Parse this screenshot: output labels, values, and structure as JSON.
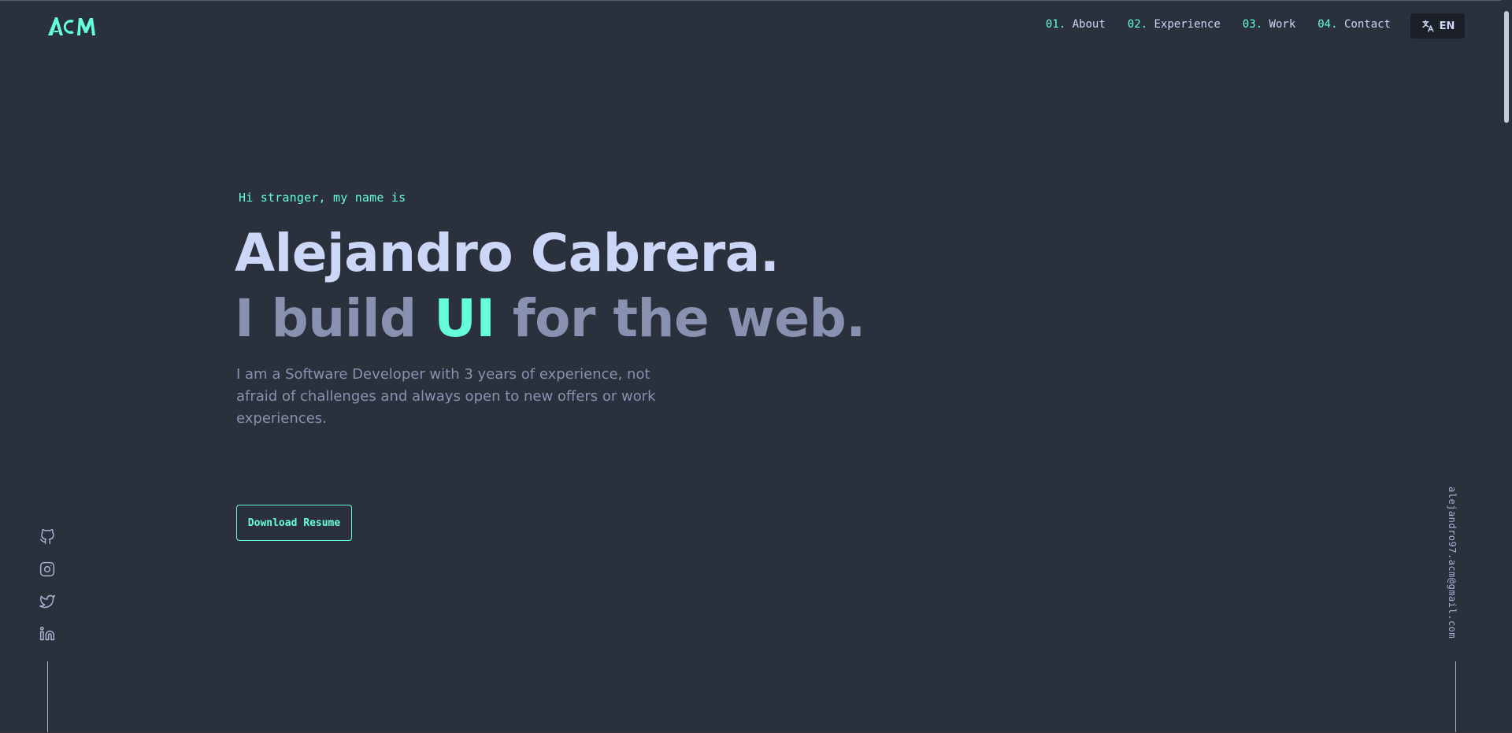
{
  "header": {
    "logo_text": "ACM",
    "nav": [
      {
        "num": "01.",
        "label": "About"
      },
      {
        "num": "02.",
        "label": "Experience"
      },
      {
        "num": "03.",
        "label": "Work"
      },
      {
        "num": "04.",
        "label": "Contact"
      }
    ],
    "language": {
      "icon": "translate-icon",
      "label": "EN"
    }
  },
  "hero": {
    "greeting": "Hi stranger, my name is",
    "name": "Alejandro Cabrera.",
    "tagline_prefix": "I build ",
    "tagline_accent": "UI",
    "tagline_suffix": " for the web.",
    "description": "I am a Software Developer with 3 years of experience, not afraid of challenges and always open to new offers or work experiences.",
    "resume_button": "Download Resume"
  },
  "socials": [
    {
      "icon": "github-icon"
    },
    {
      "icon": "instagram-icon"
    },
    {
      "icon": "twitter-icon"
    },
    {
      "icon": "linkedin-icon"
    }
  ],
  "email": "alejandro97.acm@gmail.com",
  "colors": {
    "background": "#2a303c",
    "accent": "#64ffda",
    "heading": "#ccd6f6",
    "muted": "#8892b0"
  }
}
